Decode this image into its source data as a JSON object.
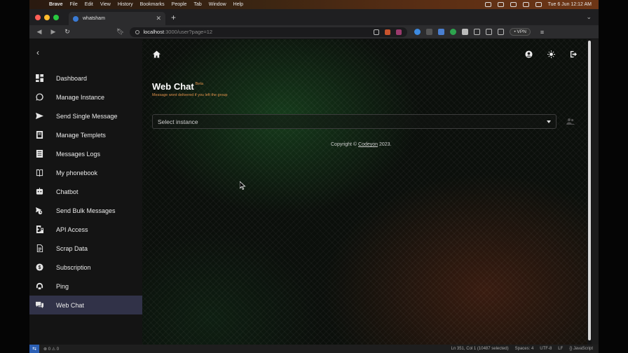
{
  "menubar": {
    "app": "Brave",
    "items": [
      "File",
      "Edit",
      "View",
      "History",
      "Bookmarks",
      "People",
      "Tab",
      "Window",
      "Help"
    ],
    "clock": "Tue 6 Jun  12:12 AM"
  },
  "browser": {
    "tab_title": "whatsham",
    "url_host": "localhost",
    "url_path": ":3000/user?page=12",
    "vpn_label": "• VPN"
  },
  "sidebar": {
    "items": [
      {
        "label": "Dashboard",
        "icon": "dashboard-icon"
      },
      {
        "label": "Manage Instance",
        "icon": "whatsapp-icon"
      },
      {
        "label": "Send Single Message",
        "icon": "send-icon"
      },
      {
        "label": "Manage Templets",
        "icon": "template-icon"
      },
      {
        "label": "Messages Logs",
        "icon": "list-icon"
      },
      {
        "label": "My phonebook",
        "icon": "book-icon"
      },
      {
        "label": "Chatbot",
        "icon": "robot-icon"
      },
      {
        "label": "Send Bulk Messages",
        "icon": "bulk-send-icon"
      },
      {
        "label": "API Access",
        "icon": "api-icon"
      },
      {
        "label": "Scrap Data",
        "icon": "scrap-icon"
      },
      {
        "label": "Subscription",
        "icon": "dollar-icon"
      },
      {
        "label": "Ping",
        "icon": "ping-icon"
      },
      {
        "label": "Web Chat",
        "icon": "chat-icon"
      }
    ],
    "active_index": 12
  },
  "main": {
    "title": "Web Chat",
    "beta": "Beta",
    "subtitle": "Message wont delivered if you left the group",
    "select_placeholder": "Select instance",
    "copyright_prefix": "Copyright © ",
    "copyright_link": "Codeyon",
    "copyright_suffix": " 2023."
  },
  "statusbar": {
    "errors": "⊗ 0 ⚠ 0",
    "position": "Ln 351, Col 1 (10487 selected)",
    "spaces": "Spaces: 4",
    "encoding": "UTF-8",
    "eol": "LF",
    "language": "{} JavaScript"
  },
  "colors": {
    "accent_orange": "#e0914a",
    "sidebar_bg": "#141414",
    "active_item_bg": "#313248"
  }
}
